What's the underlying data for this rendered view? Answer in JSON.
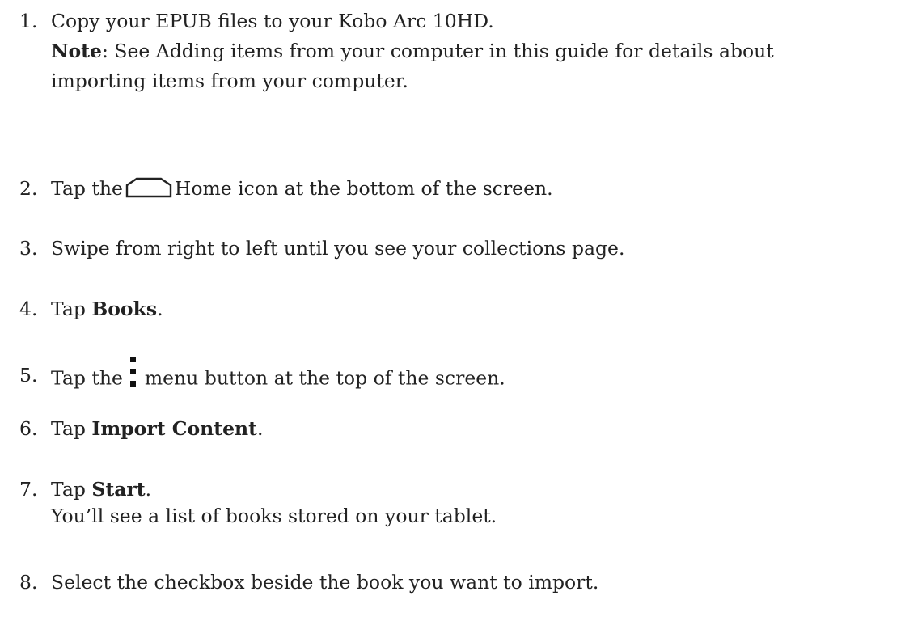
{
  "steps": [
    {
      "number": "1.",
      "text": "Copy your EPUB files to your Kobo Arc 10HD.",
      "note_label": "Note",
      "note_text": ": See Adding items from your computer in this guide for details about",
      "note_text_line2": "importing items from your computer."
    },
    {
      "number": "2.",
      "pre": "Tap the",
      "icon": "home-icon",
      "post": "Home icon at the bottom of the screen."
    },
    {
      "number": "3.",
      "text": "Swipe from right to left until you see your collections page."
    },
    {
      "number": "4.",
      "pre": "Tap ",
      "bold": "Books",
      "post": "."
    },
    {
      "number": "5.",
      "pre": "Tap the",
      "icon": "menu-icon",
      "post": "menu button at the top of the screen."
    },
    {
      "number": "6.",
      "pre": "Tap ",
      "bold": "Import Content",
      "post": "."
    },
    {
      "number": "7.",
      "pre": "Tap ",
      "bold": "Start",
      "post": ".",
      "sub": "You’ll see a list of books stored on your tablet."
    },
    {
      "number": "8.",
      "text": "Select the checkbox beside the book you want to import."
    }
  ]
}
